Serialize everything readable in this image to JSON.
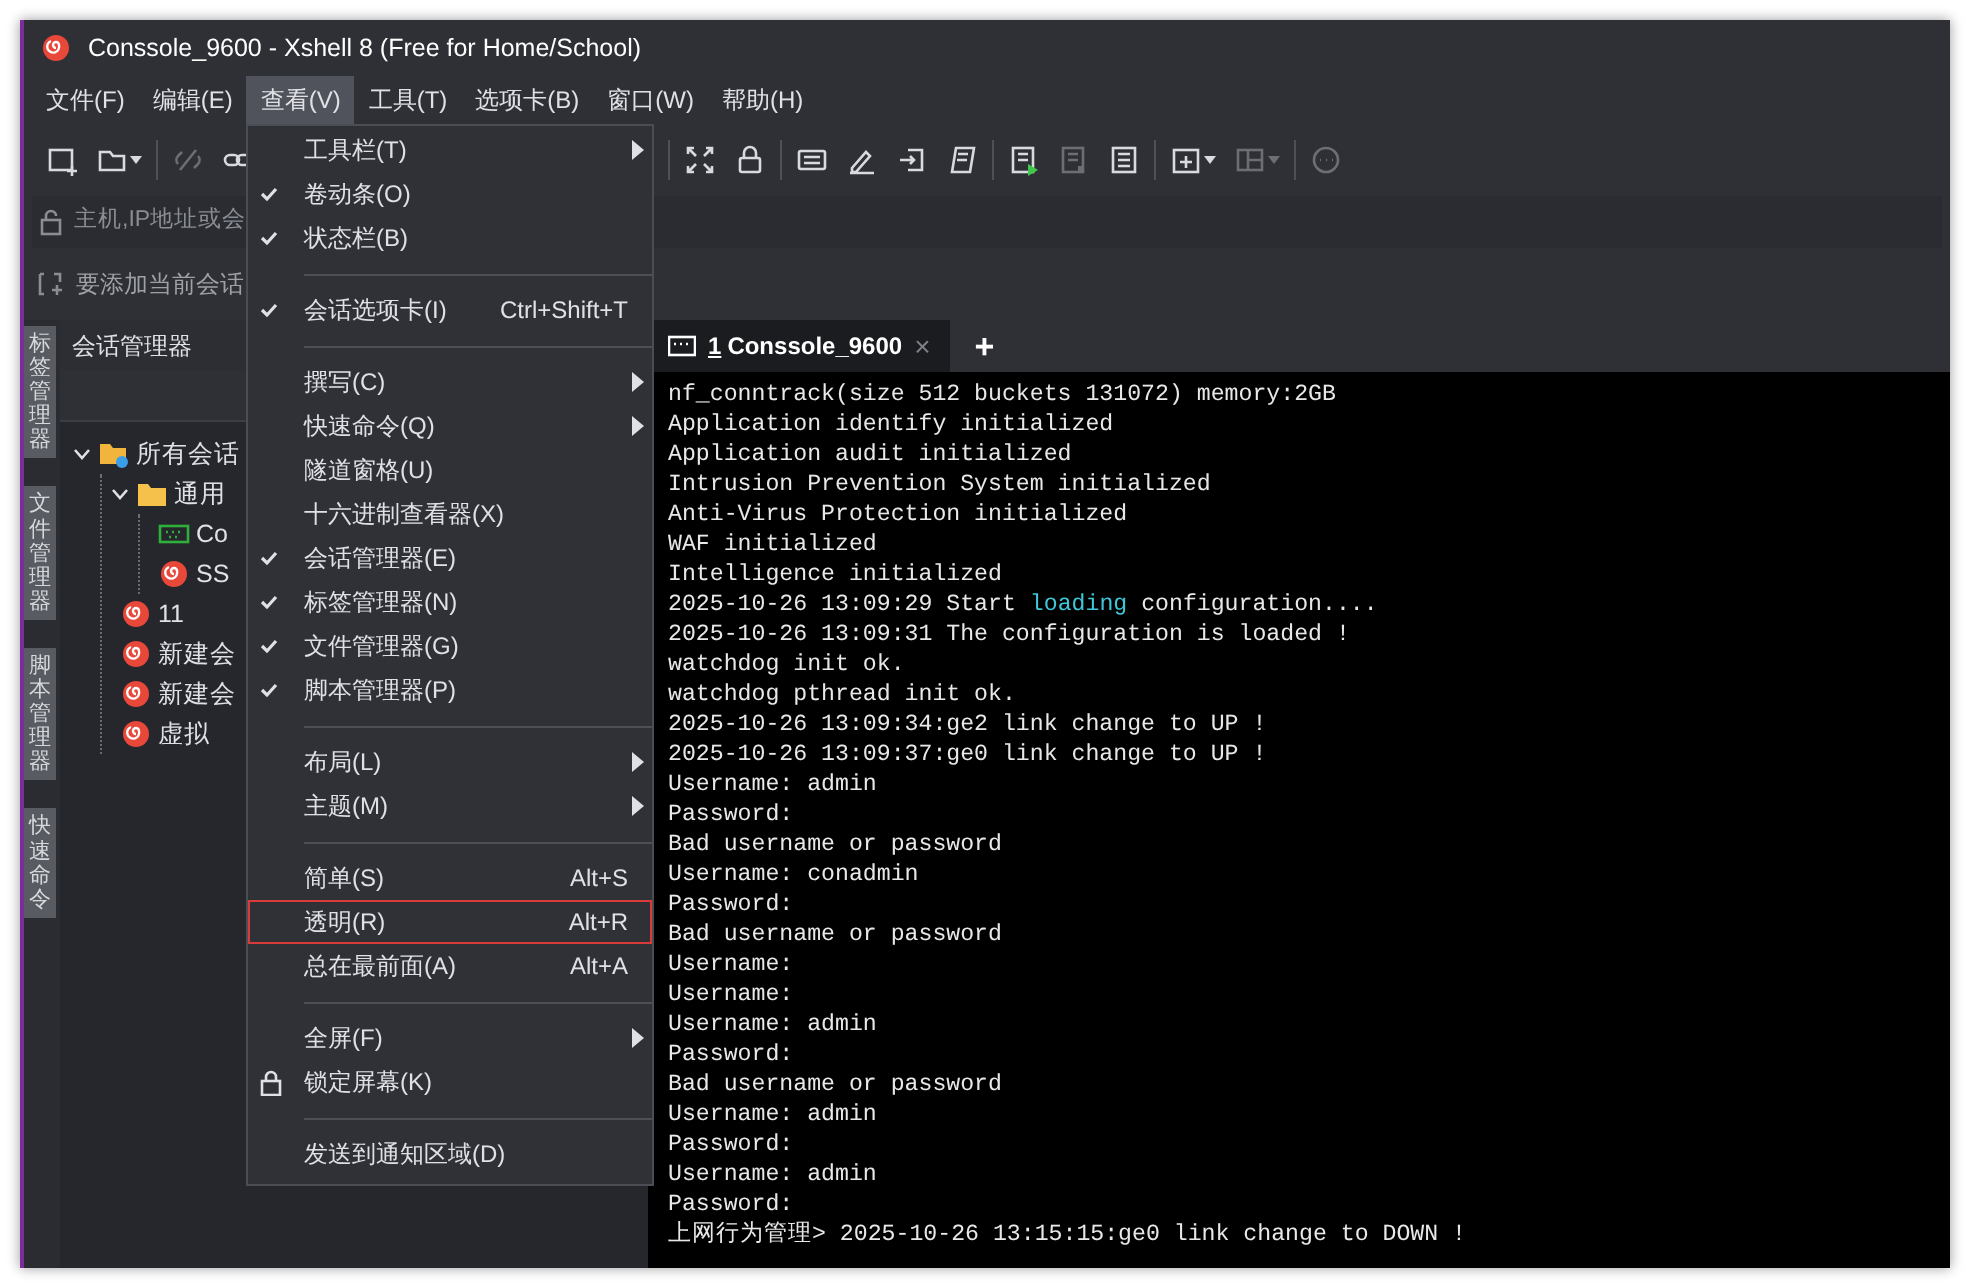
{
  "window": {
    "title": "Conssole_9600 - Xshell 8 (Free for Home/School)"
  },
  "menu_bar": [
    {
      "label": "文件(F)",
      "selected": false
    },
    {
      "label": "编辑(E)",
      "selected": false
    },
    {
      "label": "查看(V)",
      "selected": true
    },
    {
      "label": "工具(T)",
      "selected": false
    },
    {
      "label": "选项卡(B)",
      "selected": false
    },
    {
      "label": "窗口(W)",
      "selected": false
    },
    {
      "label": "帮助(H)",
      "selected": false
    }
  ],
  "toolbar": {
    "left": [
      [
        {
          "disabled": false,
          "dropdown": false
        },
        {
          "disabled": false,
          "dropdown": true
        }
      ],
      [
        {
          "disabled": true,
          "dropdown": false
        },
        {
          "disabled": false,
          "dropdown": false
        }
      ]
    ],
    "right": [
      [
        {
          "disabled": false,
          "dropdown": false
        },
        {
          "disabled": false,
          "dropdown": false
        }
      ],
      [
        {
          "disabled": false,
          "dropdown": false
        },
        {
          "disabled": false,
          "dropdown": false
        },
        {
          "disabled": false,
          "dropdown": false
        },
        {
          "disabled": false,
          "dropdown": false
        }
      ],
      [
        {
          "disabled": false,
          "dropdown": false
        },
        {
          "disabled": true,
          "dropdown": false
        },
        {
          "disabled": false,
          "dropdown": false
        }
      ],
      [
        {
          "disabled": false,
          "dropdown": true
        },
        {
          "disabled": true,
          "dropdown": true
        }
      ],
      [
        {
          "disabled": true,
          "dropdown": false
        }
      ]
    ]
  },
  "address_bar": {
    "placeholder": "主机,IP地址或会"
  },
  "hint_bar": {
    "text": "要添加当前会话"
  },
  "side_tabs": [
    {
      "label": "标签管理器"
    },
    {
      "label": "文件管理器"
    },
    {
      "label": "脚本管理器"
    },
    {
      "label": "快速命令"
    }
  ],
  "session_manager": {
    "title": "会话管理器",
    "tree": [
      {
        "label": "所有会话",
        "kind": "root",
        "expanded": true,
        "children": [
          {
            "label": "通用",
            "kind": "folder",
            "expanded": true,
            "children": [
              {
                "label": "Co",
                "kind": "serial"
              },
              {
                "label": "SS",
                "kind": "session"
              }
            ]
          },
          {
            "label": "11",
            "kind": "session"
          },
          {
            "label": "新建会",
            "kind": "session"
          },
          {
            "label": "新建会",
            "kind": "session"
          },
          {
            "label": "虚拟",
            "kind": "session"
          }
        ]
      }
    ]
  },
  "tabs": [
    {
      "number": "1",
      "label": "Conssole_9600",
      "selected": true,
      "close": "×"
    }
  ],
  "new_tab": "+",
  "terminal": {
    "lines": [
      {
        "text": "nf_conntrack(size 512 buckets 131072) memory:2GB"
      },
      {
        "text": "Application identify initialized"
      },
      {
        "text": "Application audit initialized"
      },
      {
        "text": "Intrusion Prevention System initialized"
      },
      {
        "text": "Anti-Virus Protection initialized"
      },
      {
        "text": "WAF initialized"
      },
      {
        "text": "Intelligence initialized"
      },
      {
        "parts": [
          {
            "text": "2025-10-26 13:09:29 Start ",
            "highlight": false
          },
          {
            "text": "loading",
            "highlight": true
          },
          {
            "text": " configuration....",
            "highlight": false
          }
        ]
      },
      {
        "text": "2025-10-26 13:09:31 The configuration is loaded !"
      },
      {
        "text": "watchdog init ok."
      },
      {
        "text": "watchdog pthread init ok."
      },
      {
        "text": "2025-10-26 13:09:34:ge2 link change to UP !"
      },
      {
        "text": "2025-10-26 13:09:37:ge0 link change to UP !"
      },
      {
        "text": "Username: admin"
      },
      {
        "text": "Password:"
      },
      {
        "text": "Bad username or password"
      },
      {
        "text": "Username: conadmin"
      },
      {
        "text": "Password:"
      },
      {
        "text": "Bad username or password"
      },
      {
        "text": "Username:"
      },
      {
        "text": "Username:"
      },
      {
        "text": "Username: admin"
      },
      {
        "text": "Password:"
      },
      {
        "text": "Bad username or password"
      },
      {
        "text": "Username: admin"
      },
      {
        "text": "Password:"
      },
      {
        "text": "Username: admin"
      },
      {
        "text": "Password:"
      },
      {
        "text": "上网行为管理> 2025-10-26 13:15:15:ge0 link change to DOWN !"
      }
    ]
  },
  "view_menu": {
    "items": [
      {
        "kind": "item",
        "label": "工具栏(T)",
        "checked": false,
        "submenu": true
      },
      {
        "kind": "item",
        "label": "卷动条(O)",
        "checked": true,
        "submenu": false
      },
      {
        "kind": "item",
        "label": "状态栏(B)",
        "checked": true,
        "submenu": false
      },
      {
        "kind": "separator"
      },
      {
        "kind": "item",
        "label": "会话选项卡(I)",
        "checked": true,
        "submenu": false,
        "shortcut": "Ctrl+Shift+T"
      },
      {
        "kind": "separator"
      },
      {
        "kind": "item",
        "label": "撰写(C)",
        "checked": false,
        "submenu": true
      },
      {
        "kind": "item",
        "label": "快速命令(Q)",
        "checked": false,
        "submenu": true
      },
      {
        "kind": "item",
        "label": "隧道窗格(U)",
        "checked": false,
        "submenu": false
      },
      {
        "kind": "item",
        "label": "十六进制查看器(X)",
        "checked": false,
        "submenu": false
      },
      {
        "kind": "item",
        "label": "会话管理器(E)",
        "checked": true,
        "submenu": false
      },
      {
        "kind": "item",
        "label": "标签管理器(N)",
        "checked": true,
        "submenu": false
      },
      {
        "kind": "item",
        "label": "文件管理器(G)",
        "checked": true,
        "submenu": false
      },
      {
        "kind": "item",
        "label": "脚本管理器(P)",
        "checked": true,
        "submenu": false
      },
      {
        "kind": "separator"
      },
      {
        "kind": "item",
        "label": "布局(L)",
        "checked": false,
        "submenu": true
      },
      {
        "kind": "item",
        "label": "主题(M)",
        "checked": false,
        "submenu": true
      },
      {
        "kind": "separator"
      },
      {
        "kind": "item",
        "label": "简单(S)",
        "checked": false,
        "submenu": false,
        "shortcut": "Alt+S"
      },
      {
        "kind": "item",
        "label": "透明(R)",
        "checked": false,
        "submenu": false,
        "shortcut": "Alt+R",
        "outlined": true
      },
      {
        "kind": "item",
        "label": "总在最前面(A)",
        "checked": false,
        "submenu": false,
        "shortcut": "Alt+A"
      },
      {
        "kind": "separator"
      },
      {
        "kind": "item",
        "label": "全屏(F)",
        "checked": false,
        "submenu": true
      },
      {
        "kind": "item",
        "label": "锁定屏幕(K)",
        "checked": false,
        "submenu": false,
        "locked": true
      },
      {
        "kind": "separator"
      },
      {
        "kind": "item",
        "label": "发送到通知区域(D)",
        "checked": false,
        "submenu": false
      }
    ]
  }
}
